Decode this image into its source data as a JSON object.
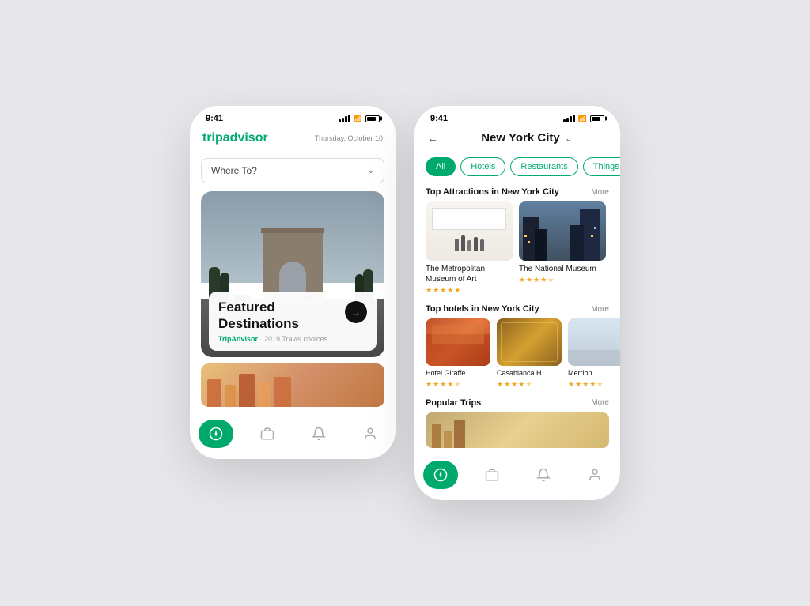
{
  "phone1": {
    "status": {
      "time": "9:41",
      "time2": "9:41"
    },
    "header": {
      "logo_trip": "trip",
      "logo_advisor": "advisor",
      "date": "Thursday, October 10"
    },
    "search": {
      "placeholder": "Where To?",
      "chevron": "⌄"
    },
    "featured": {
      "title": "Featured\nDestinations",
      "brand": "TripAdvisor",
      "subtitle": "2019 Travel choices",
      "arrow": "→"
    },
    "nav": {
      "items": [
        {
          "icon": "⊙",
          "label": "explore",
          "active": true
        },
        {
          "icon": "⊡",
          "label": "trips",
          "active": false
        },
        {
          "icon": "♪",
          "label": "notifications",
          "active": false
        },
        {
          "icon": "◯",
          "label": "profile",
          "active": false
        }
      ]
    }
  },
  "phone2": {
    "header": {
      "back": "←",
      "city": "New York City",
      "chevron": "⌄"
    },
    "filter_tabs": [
      {
        "label": "All",
        "active": true
      },
      {
        "label": "Hotels",
        "active": false
      },
      {
        "label": "Restaurants",
        "active": false
      },
      {
        "label": "Things",
        "active": false
      }
    ],
    "attractions": {
      "section_title": "Top Attractions in New York City",
      "more": "More",
      "items": [
        {
          "name": "The Metropolitan\nMuseum of Art",
          "stars": 5,
          "half_star": false
        },
        {
          "name": "The National\nMuseum",
          "stars": 4,
          "half_star": true
        }
      ]
    },
    "hotels": {
      "section_title": "Top hotels in New York City",
      "more": "More",
      "items": [
        {
          "name": "Hotel Giraffe...",
          "stars": 4,
          "half_star": true
        },
        {
          "name": "Casablanca H...",
          "stars": 4,
          "half_star": true
        },
        {
          "name": "Merrion",
          "stars": 4,
          "half_star": true
        }
      ]
    },
    "popular_trips": {
      "section_title": "Popular Trips",
      "more": "More"
    },
    "nav": {
      "items": [
        {
          "icon": "⊙",
          "label": "explore",
          "active": true
        },
        {
          "icon": "⊡",
          "label": "trips",
          "active": false
        },
        {
          "icon": "♪",
          "label": "notifications",
          "active": false
        },
        {
          "icon": "◯",
          "label": "profile",
          "active": false
        }
      ]
    }
  }
}
